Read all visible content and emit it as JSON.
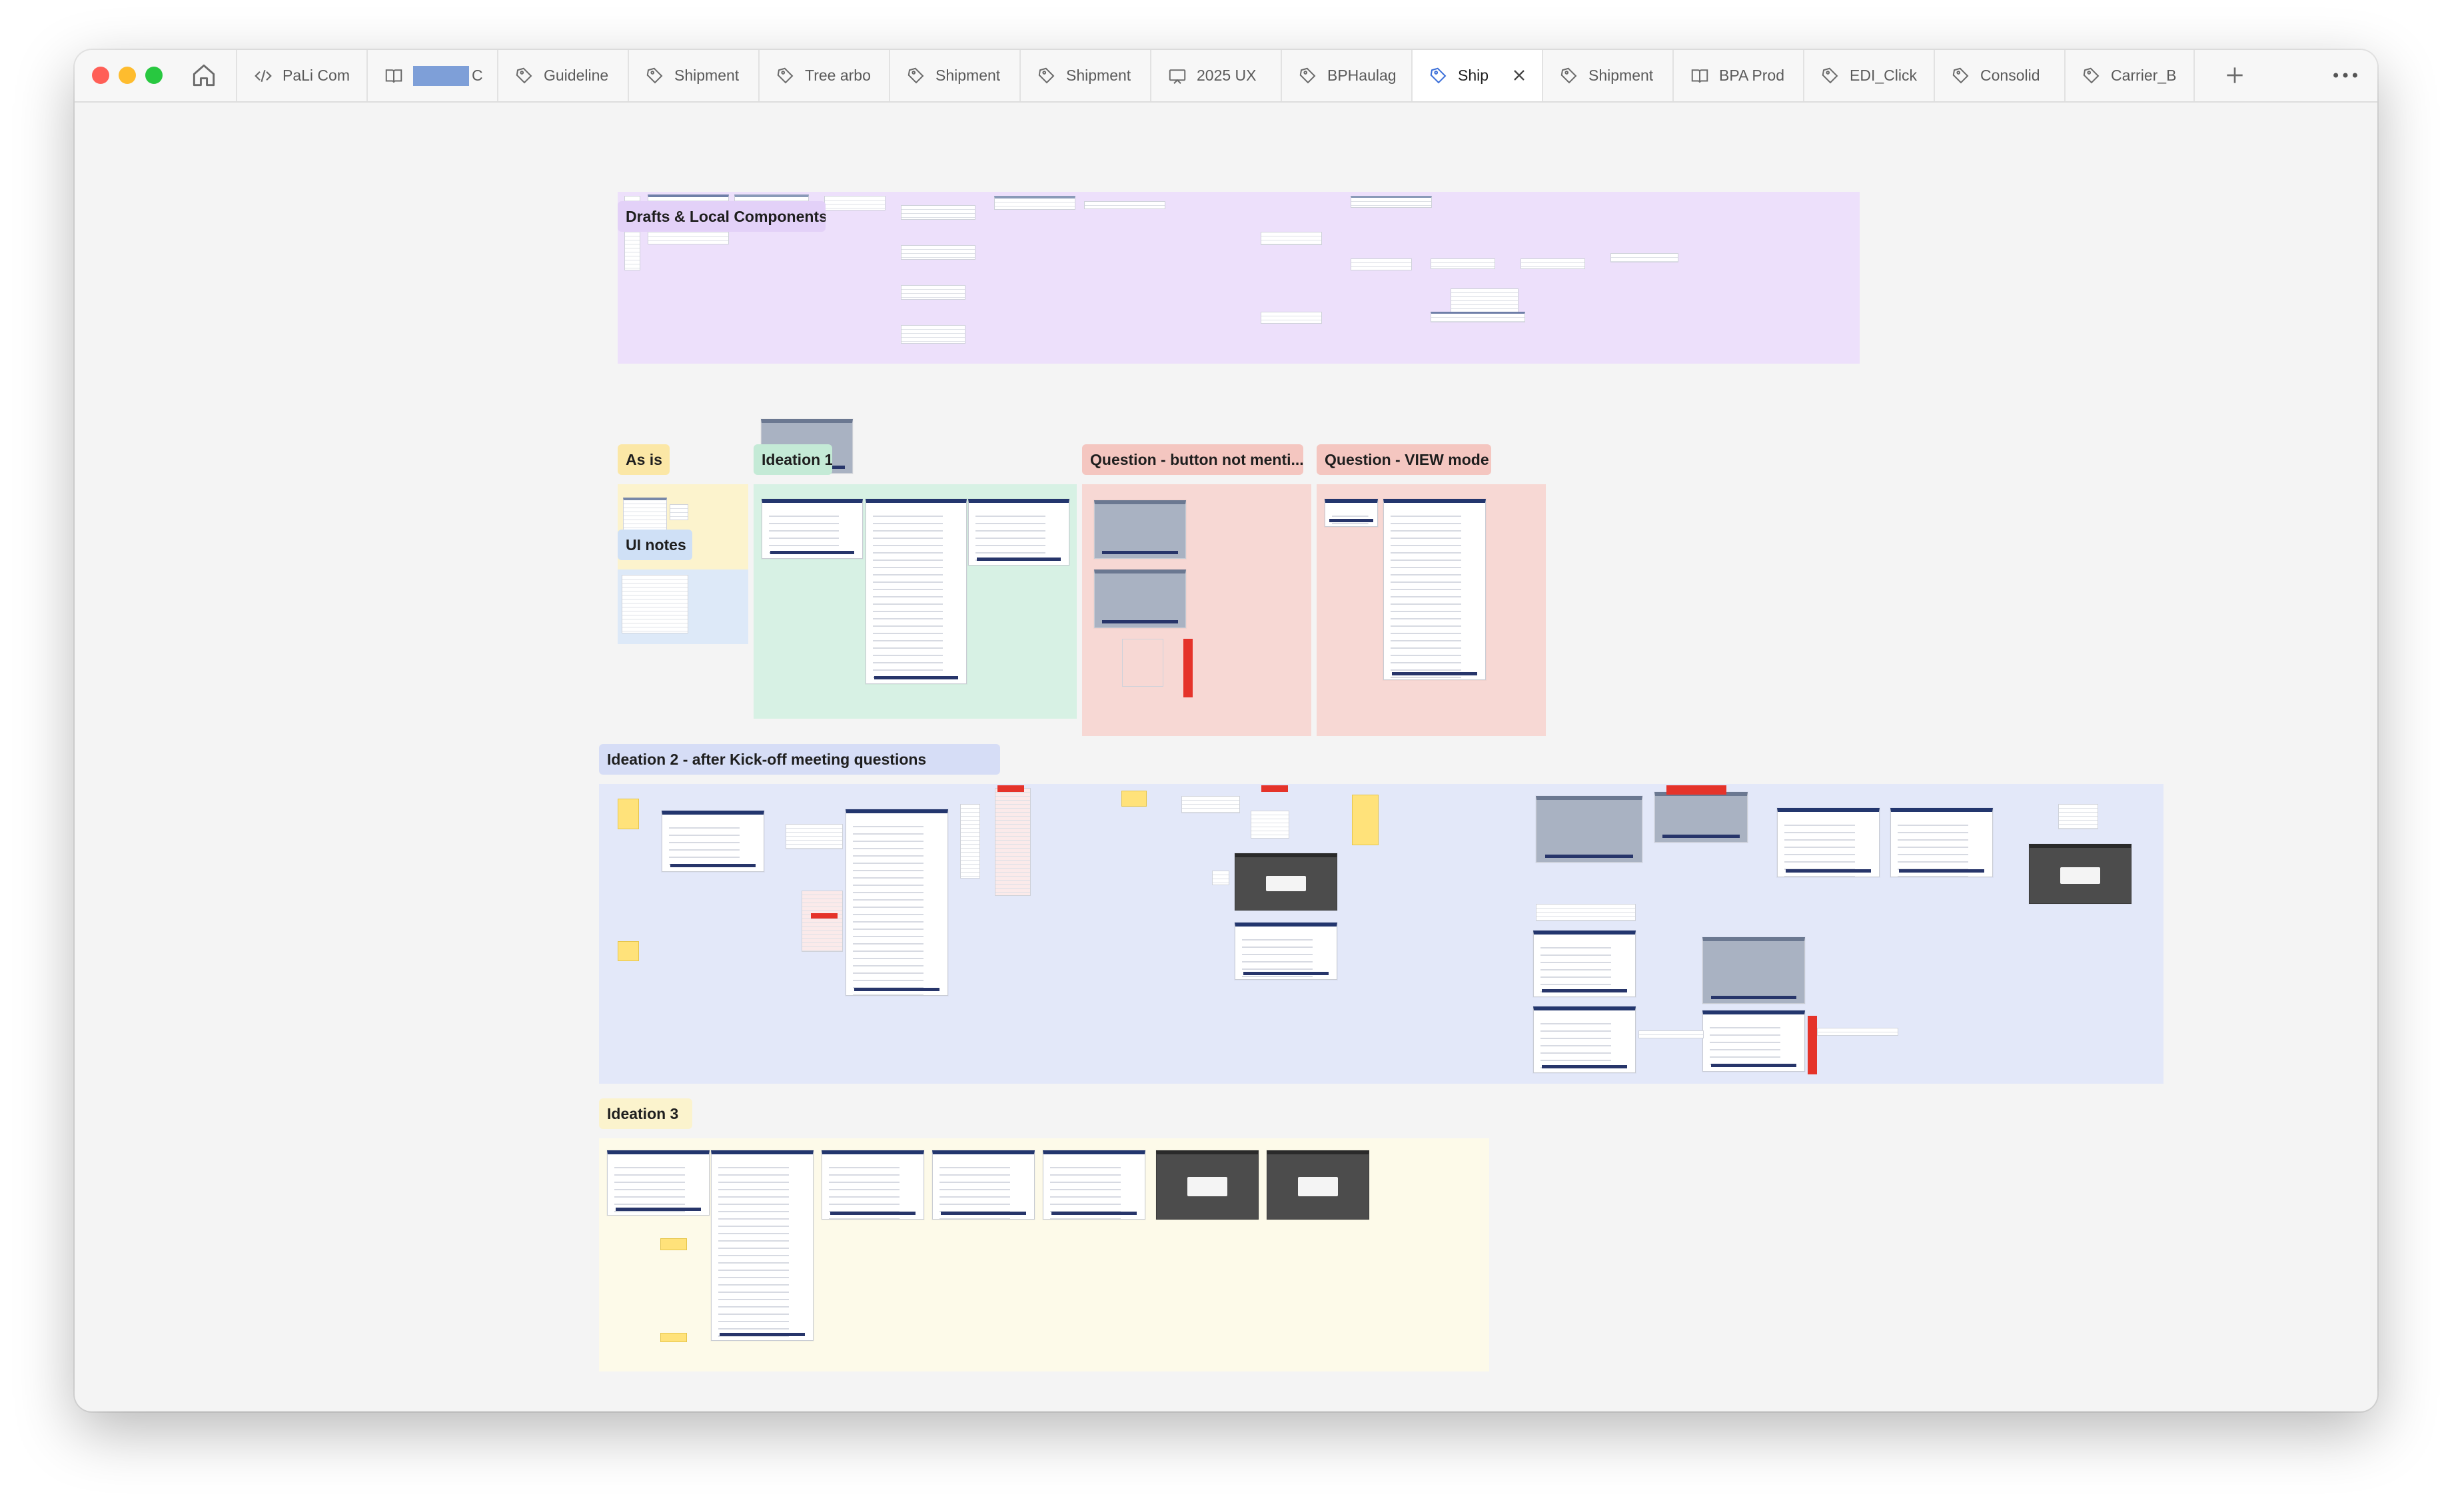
{
  "window": {
    "traffic_lights": [
      {
        "name": "close",
        "color": "#ff5f57"
      },
      {
        "name": "minimize",
        "color": "#febc2e"
      },
      {
        "name": "zoom",
        "color": "#28c840"
      }
    ]
  },
  "tabs": [
    {
      "label": "PaLi Com",
      "icon": "code-icon"
    },
    {
      "label": "C",
      "icon": "book-icon",
      "redacted": true
    },
    {
      "label": "Guideline",
      "icon": "figma-icon"
    },
    {
      "label": "Shipment",
      "icon": "figma-icon"
    },
    {
      "label": "Tree arbo",
      "icon": "figma-icon"
    },
    {
      "label": "Shipment",
      "icon": "figma-icon"
    },
    {
      "label": "Shipment",
      "icon": "figma-icon"
    },
    {
      "label": "2025 UX",
      "icon": "slides-icon"
    },
    {
      "label": "BPHaulag",
      "icon": "figma-icon"
    },
    {
      "label": "Ship",
      "icon": "figma-icon",
      "active": true
    },
    {
      "label": "Shipment",
      "icon": "figma-icon"
    },
    {
      "label": "BPA Prod",
      "icon": "book-icon"
    },
    {
      "label": "EDI_Click",
      "icon": "figma-icon"
    },
    {
      "label": "Consolid",
      "icon": "figma-icon"
    },
    {
      "label": "Carrier_B",
      "icon": "figma-icon"
    }
  ],
  "sections": [
    {
      "label": "Drafts & Local Components",
      "color": "#ede0fb",
      "label_color": "#e3d1f8"
    },
    {
      "label": "As is",
      "color": "#fcf3cd",
      "label_color": "#fbe7a6"
    },
    {
      "label": "UI notes",
      "color": "#dde9f8",
      "label_color": "#cfe0f6"
    },
    {
      "label": "Ideation 1",
      "color": "#d7f1e4",
      "label_color": "#c4ead6"
    },
    {
      "label": "Question - button not menti...",
      "color": "#f7d8d4",
      "label_color": "#f4c6c0"
    },
    {
      "label": "Question - VIEW mode",
      "color": "#f7d8d4",
      "label_color": "#f4c6c0"
    },
    {
      "label": "Ideation 2 - after Kick-off meeting questions",
      "color": "#e3e8f9",
      "label_color": "#d6ddf6"
    },
    {
      "label": "Ideation 3",
      "color": "#fdfae9",
      "label_color": "#fbf3cd"
    }
  ]
}
